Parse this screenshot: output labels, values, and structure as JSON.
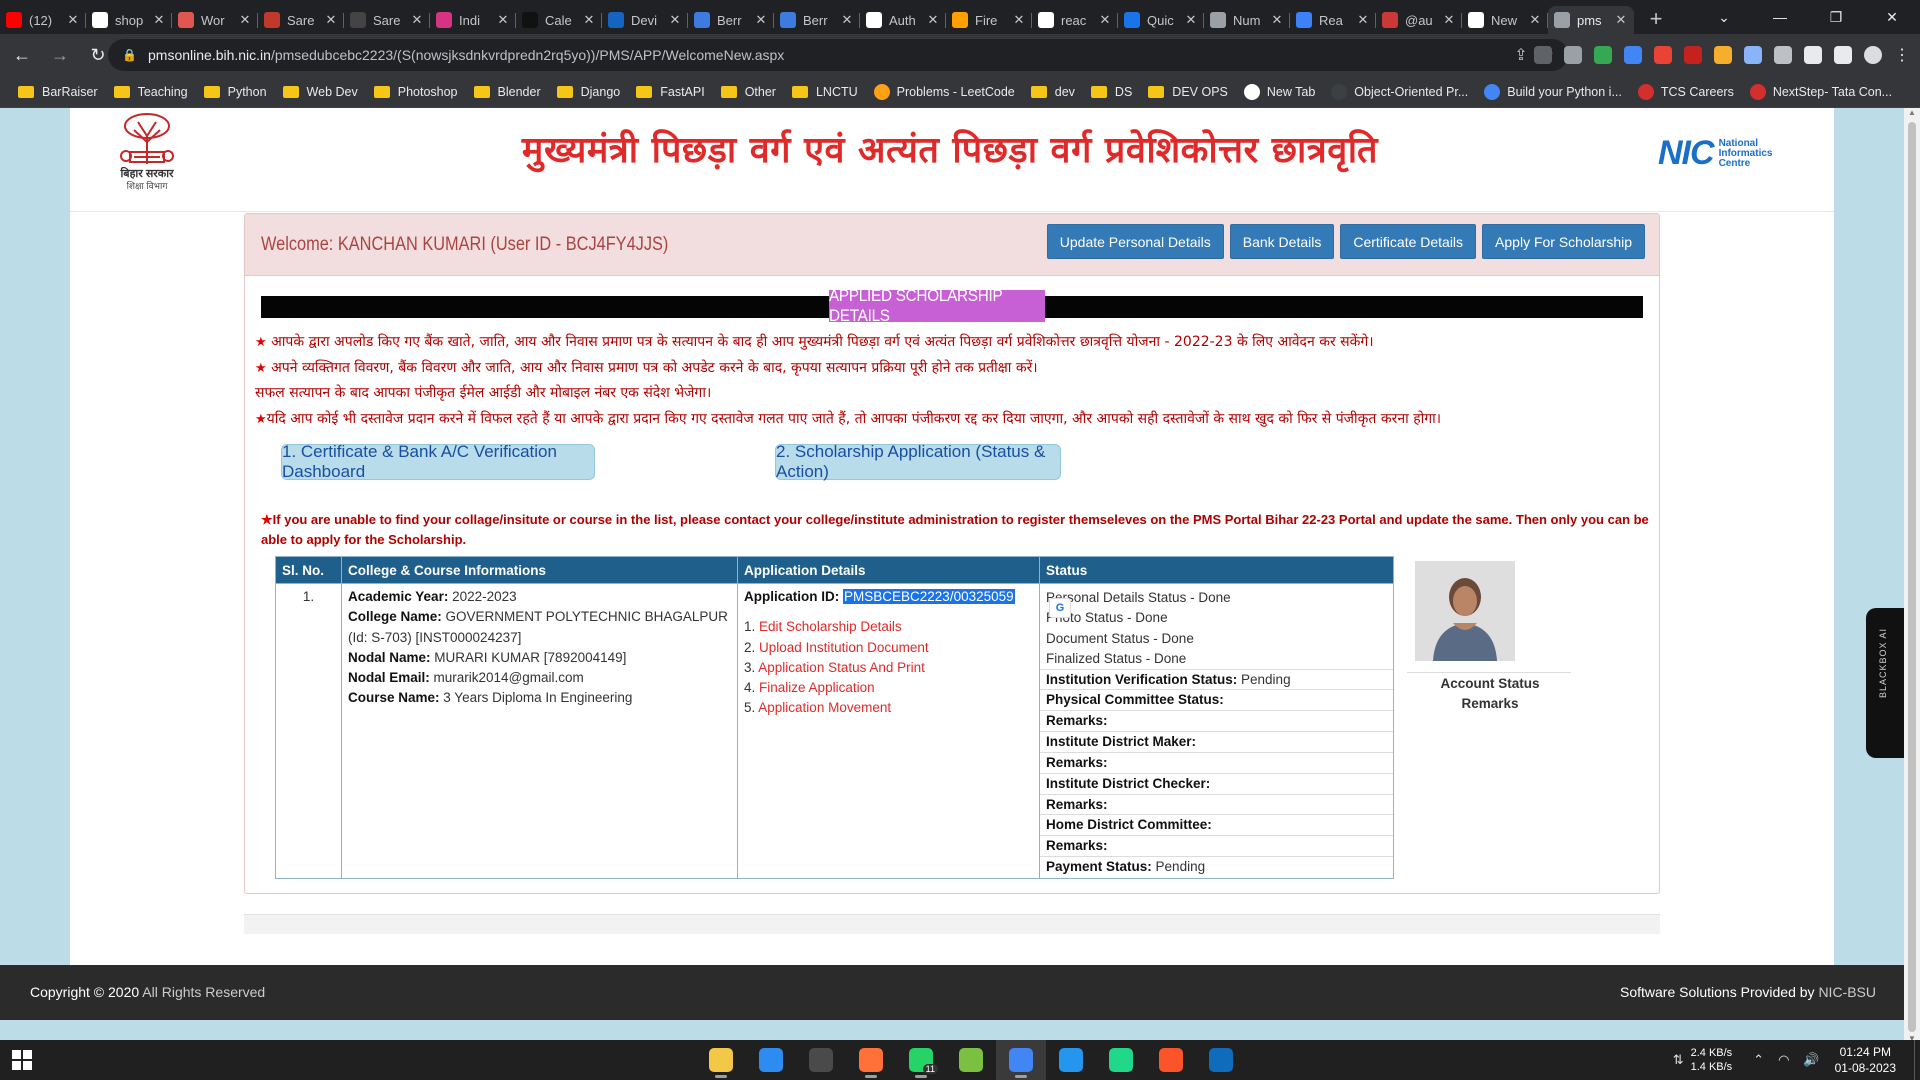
{
  "browser": {
    "tabs": [
      {
        "title": "(12)",
        "icon": "youtube-icon",
        "color": "#ff0000"
      },
      {
        "title": "shop",
        "icon": "google-icon",
        "color": "#ffffff"
      },
      {
        "title": "Wor",
        "icon": "bookmark-app-icon",
        "color": "#e0574f"
      },
      {
        "title": "Sare",
        "icon": "saree-icon",
        "color": "#c0392b"
      },
      {
        "title": "Sare",
        "icon": "saree-site-icon",
        "color": "#444444"
      },
      {
        "title": "Indi",
        "icon": "indic-icon",
        "color": "#d63384"
      },
      {
        "title": "Cale",
        "icon": "calendar-icon",
        "color": "#111111"
      },
      {
        "title": "Devi",
        "icon": "devicon-icon",
        "color": "#1565c0"
      },
      {
        "title": "Berr",
        "icon": "edit-page-icon",
        "color": "#3d7be0"
      },
      {
        "title": "Berr",
        "icon": "edit-page-icon",
        "color": "#3d7be0"
      },
      {
        "title": "Auth",
        "icon": "auth-icon",
        "color": "#ffffff"
      },
      {
        "title": "Fire",
        "icon": "firebase-icon",
        "color": "#ffa000"
      },
      {
        "title": "reac",
        "icon": "google-icon",
        "color": "#ffffff"
      },
      {
        "title": "Quic",
        "icon": "quick-icon",
        "color": "#1a73e8"
      },
      {
        "title": "Num",
        "icon": "globe-icon",
        "color": "#9aa0a6"
      },
      {
        "title": "Rea",
        "icon": "react-icon",
        "color": "#3b82f6"
      },
      {
        "title": "@au",
        "icon": "npm-icon",
        "color": "#cb3837"
      },
      {
        "title": "New",
        "icon": "github-icon",
        "color": "#ffffff"
      },
      {
        "title": "pms",
        "icon": "globe-icon",
        "color": "#9aa0a6",
        "active": true
      }
    ],
    "url_host": "pmsonline.bih.nic.in",
    "url_path": "/pmsedubcebc2223/(S(nowsjksdnkvrdpredn2rq5yo))/PMS/APP/WelcomeNew.aspx",
    "bookmarks": [
      {
        "label": "BarRaiser",
        "type": "folder"
      },
      {
        "label": "Teaching",
        "type": "folder"
      },
      {
        "label": "Python",
        "type": "folder"
      },
      {
        "label": "Web Dev",
        "type": "folder"
      },
      {
        "label": "Photoshop",
        "type": "folder"
      },
      {
        "label": "Blender",
        "type": "folder"
      },
      {
        "label": "Django",
        "type": "folder"
      },
      {
        "label": "FastAPI",
        "type": "folder"
      },
      {
        "label": "Other",
        "type": "folder"
      },
      {
        "label": "LNCTU",
        "type": "folder"
      },
      {
        "label": "Problems - LeetCode",
        "type": "site",
        "color": "#ffa116"
      },
      {
        "label": "dev",
        "type": "folder"
      },
      {
        "label": "DS",
        "type": "folder"
      },
      {
        "label": "DEV OPS",
        "type": "folder"
      },
      {
        "label": "New Tab",
        "type": "site",
        "color": "#ffffff"
      },
      {
        "label": "Object-Oriented Pr...",
        "type": "site",
        "color": "#3c4043"
      },
      {
        "label": "Build your Python i...",
        "type": "site",
        "color": "#4285f4"
      },
      {
        "label": "TCS Careers",
        "type": "site",
        "color": "#d32f2f"
      },
      {
        "label": "NextStep- Tata Con...",
        "type": "site",
        "color": "#d32f2f"
      }
    ]
  },
  "header": {
    "title": "मुख्यमंत्री पिछड़ा वर्ग एवं अत्यंत पिछड़ा वर्ग प्रवेशिकोत्तर छात्रवृति",
    "emblem_text": "बिहार सरकार",
    "emblem_sub": "शिक्षा विभाग",
    "nic_word": "NIC",
    "nic_sub": [
      "National",
      "Informatics",
      "Centre"
    ]
  },
  "welcome": {
    "text": "Welcome: KANCHAN KUMARI (User ID - BCJ4FY4JJS)",
    "buttons": [
      "Update Personal Details",
      "Bank Details",
      "Certificate Details",
      "Apply For Scholarship"
    ]
  },
  "section_title": "APPLIED SCHOLARSHIP DETAILS",
  "notes": [
    "आपके द्वारा अपलोड किए गए बैंक खाते, जाति, आय और निवास प्रमाण पत्र के सत्यापन के बाद ही आप मुख्यमंत्री पिछड़ा वर्ग एवं अत्यंत पिछड़ा वर्ग प्रवेशिकोत्तर छात्रवृत्ति योजना - 2022-23 के लिए आवेदन कर सकेंगे।",
    "अपने व्यक्तिगत विवरण, बैंक विवरण और जाति, आय और निवास प्रमाण पत्र को अपडेट करने के बाद, कृपया सत्यापन प्रक्रिया पूरी होने तक प्रतीक्षा करें।",
    "सफल सत्यापन के बाद आपका पंजीकृत ईमेल आईडी और मोबाइल नंबर एक संदेश भेजेगा।",
    "यदि आप कोई भी दस्तावेज प्रदान करने में विफल रहते हैं या आपके द्वारा प्रदान किए गए दस्तावेज गलत पाए जाते हैं, तो आपका पंजीकरण रद्द कर दिया जाएगा, और आपको सही दस्तावेजों के साथ खुद को फिर से पंजीकृत करना होगा।"
  ],
  "dashboard_buttons": [
    "1. Certificate & Bank A/C Verification Dashboard",
    "2. Scholarship Application (Status & Action)"
  ],
  "warning": "If you are unable to find your collage/insitute or course in the list, please contact your college/institute administration to register themseleves on the PMS Portal Bihar 22-23 Portal and update the same. Then only you can be able to apply for the Scholarship.",
  "table": {
    "headers": [
      "Sl. No.",
      "College & Course Informations",
      "Application Details",
      "Status"
    ],
    "row": {
      "sl": "1.",
      "college": [
        {
          "label": "Academic Year:",
          "value": "2022-2023"
        },
        {
          "label": "College Name:",
          "value": "GOVERNMENT POLYTECHNIC BHAGALPUR (Id: S-703) [INST000024237]"
        },
        {
          "label": "Nodal Name:",
          "value": "MURARI KUMAR [7892004149]"
        },
        {
          "label": "Nodal Email:",
          "value": "murarik2014@gmail.com"
        },
        {
          "label": "Course Name:",
          "value": "3 Years Diploma In Engineering"
        }
      ],
      "app_id_label": "Application ID:",
      "app_id": "PMSBCEBC2223/00325059",
      "app_links": [
        {
          "num": "1.",
          "label": "Edit Scholarship Details"
        },
        {
          "num": "2.",
          "label": "Upload Institution Document"
        },
        {
          "num": "3.",
          "label": "Application Status And Print"
        },
        {
          "num": "4.",
          "label": "Finalize Application"
        },
        {
          "num": "5.",
          "label": "Application Movement"
        }
      ],
      "status_lines": [
        "Personal Details Status - Done",
        "Photo Status - Done",
        "Document Status - Done",
        "Finalized Status - Done"
      ],
      "status_rows": [
        {
          "label": "Institution Verification Status:",
          "value": "Pending"
        },
        {
          "label": "Physical Committee Status:",
          "value": ""
        },
        {
          "label": "Remarks:",
          "value": ""
        },
        {
          "label": "Institute District Maker:",
          "value": ""
        },
        {
          "label": "Remarks:",
          "value": ""
        },
        {
          "label": "Institute District Checker:",
          "value": ""
        },
        {
          "label": "Remarks:",
          "value": ""
        },
        {
          "label": "Home District Committee:",
          "value": ""
        },
        {
          "label": "Remarks:",
          "value": ""
        },
        {
          "label": "Payment Status:",
          "value": "Pending"
        }
      ]
    }
  },
  "account": {
    "line1": "Account Status",
    "line2": "Remarks"
  },
  "footer": {
    "copyright_bold": "Copyright © 2020",
    "copyright_rest": "All Rights Reserved",
    "provider_prefix": "Software Solutions Provided by",
    "provider": "NIC-BSU"
  },
  "blackbox_label": "BLACKBOX AI",
  "taskbar": {
    "apps": [
      {
        "name": "file-explorer-icon",
        "color": "#f3c846",
        "running": true
      },
      {
        "name": "vscode-icon",
        "color": "#2d8cf0",
        "running": false
      },
      {
        "name": "terminal-icon",
        "color": "#4a4a4a",
        "running": false
      },
      {
        "name": "firefox-icon",
        "color": "#ff7139",
        "running": true
      },
      {
        "name": "whatsapp-icon",
        "color": "#25d366",
        "running": true,
        "badge": "11"
      },
      {
        "name": "swirl-app-icon",
        "color": "#7ac142",
        "running": false
      },
      {
        "name": "chrome-icon",
        "color": "#4285f4",
        "running": true,
        "active": true
      },
      {
        "name": "docker-icon",
        "color": "#2496ed",
        "running": false
      },
      {
        "name": "pycharm-icon",
        "color": "#21d789",
        "running": false
      },
      {
        "name": "brave-icon",
        "color": "#fb542b",
        "running": false
      },
      {
        "name": "photos-icon",
        "color": "#0f6cbd",
        "running": false
      }
    ],
    "net_down": "2.4 KB/s",
    "net_up": "1.4 KB/s",
    "time": "01:24 PM",
    "date": "01-08-2023"
  }
}
